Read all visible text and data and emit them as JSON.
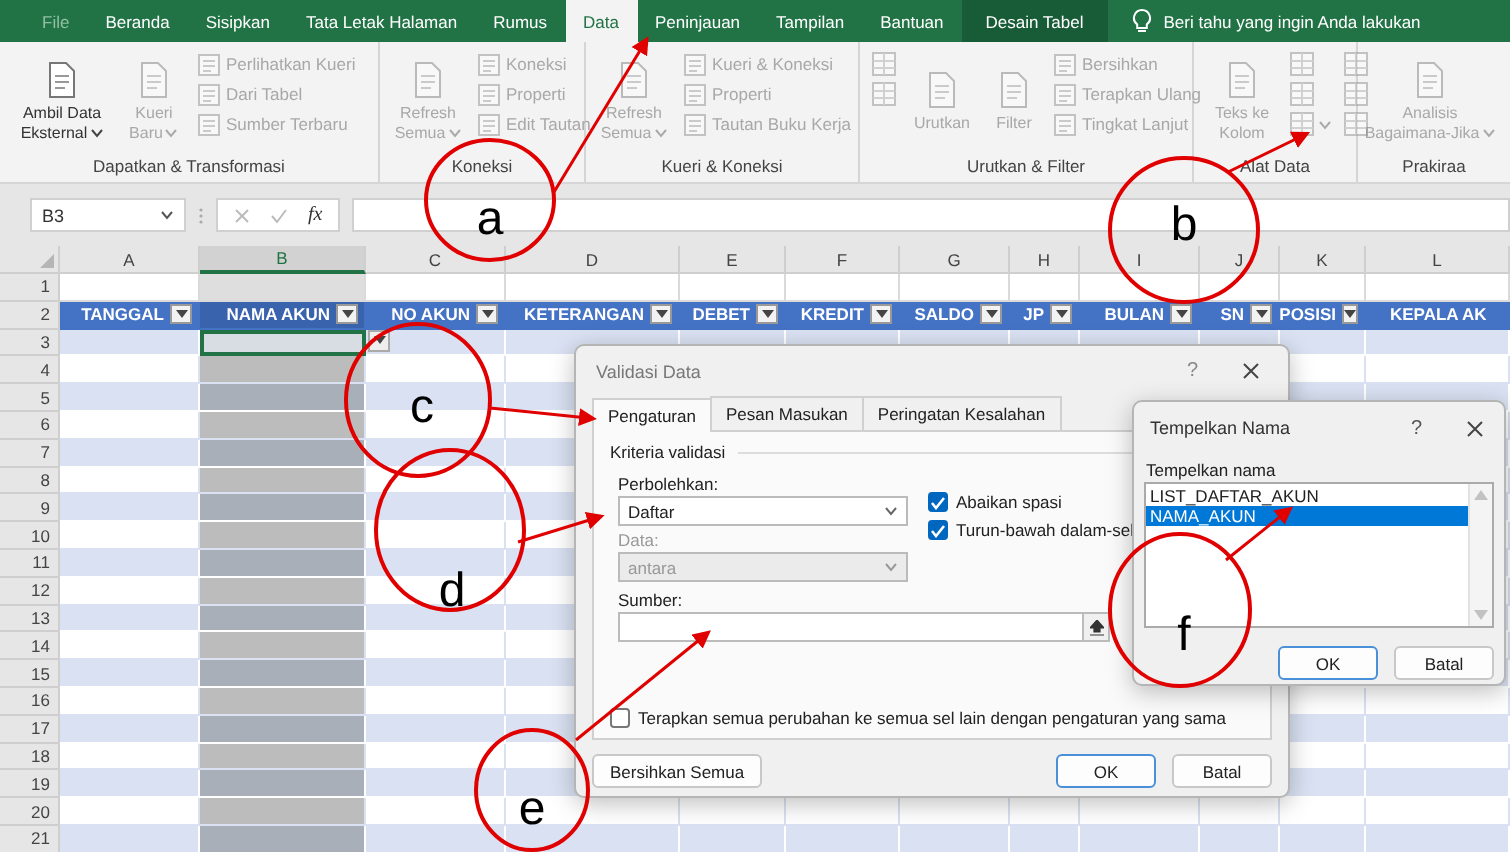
{
  "ribbon_tabs": [
    {
      "label": "File",
      "kind": "backstage",
      "selected": false
    },
    {
      "label": "Beranda",
      "kind": "standard",
      "selected": false
    },
    {
      "label": "Sisipkan",
      "kind": "standard",
      "selected": false
    },
    {
      "label": "Tata Letak Halaman",
      "kind": "standard",
      "selected": false
    },
    {
      "label": "Rumus",
      "kind": "standard",
      "selected": false
    },
    {
      "label": "Data",
      "kind": "standard",
      "selected": true
    },
    {
      "label": "Peninjauan",
      "kind": "standard",
      "selected": false
    },
    {
      "label": "Tampilan",
      "kind": "standard",
      "selected": false
    },
    {
      "label": "Bantuan",
      "kind": "standard",
      "selected": false
    },
    {
      "label": "Desain Tabel",
      "kind": "contextual",
      "selected": false
    }
  ],
  "tell_me": {
    "text": "Beri tahu yang ingin Anda lakukan"
  },
  "ribbon_groups": [
    {
      "title": "Dapatkan & Transformasi",
      "items": [
        {
          "kind": "large",
          "label": "Ambil Data Eksternal",
          "dropdown": true,
          "disabled": false
        },
        {
          "kind": "large",
          "label": "Kueri Baru",
          "dropdown": true,
          "disabled": true
        },
        {
          "kind": "stack",
          "items": [
            {
              "label": "Perlihatkan Kueri",
              "disabled": true
            },
            {
              "label": "Dari Tabel",
              "disabled": true
            },
            {
              "label": "Sumber Terbaru",
              "disabled": true
            }
          ]
        }
      ]
    },
    {
      "title": "Koneksi",
      "items": [
        {
          "kind": "large",
          "label": "Refresh Semua",
          "dropdown": true,
          "disabled": true
        },
        {
          "kind": "stack",
          "items": [
            {
              "label": "Koneksi",
              "disabled": true
            },
            {
              "label": "Properti",
              "disabled": true
            },
            {
              "label": "Edit Tautan",
              "disabled": true
            }
          ]
        }
      ]
    },
    {
      "title": "Kueri & Koneksi",
      "items": [
        {
          "kind": "large",
          "label": "Refresh Semua",
          "dropdown": true,
          "disabled": true
        },
        {
          "kind": "stack",
          "items": [
            {
              "label": "Kueri & Koneksi",
              "disabled": true
            },
            {
              "label": "Properti",
              "disabled": true
            },
            {
              "label": "Tautan Buku Kerja",
              "disabled": true
            }
          ]
        }
      ]
    },
    {
      "title": "Urutkan & Filter",
      "items": [
        {
          "kind": "icons",
          "items": [
            {
              "disabled": true,
              "dropdown": false
            },
            {
              "disabled": true,
              "dropdown": false
            }
          ]
        },
        {
          "kind": "large",
          "label": "Urutkan",
          "dropdown": false,
          "disabled": true
        },
        {
          "kind": "large",
          "label": "Filter",
          "dropdown": false,
          "disabled": true
        },
        {
          "kind": "stack",
          "items": [
            {
              "label": "Bersihkan",
              "disabled": true
            },
            {
              "label": "Terapkan Ulang",
              "disabled": true
            },
            {
              "label": "Tingkat Lanjut",
              "disabled": true
            }
          ]
        }
      ]
    },
    {
      "title": "Alat Data",
      "items": [
        {
          "kind": "large",
          "label": "Teks ke Kolom",
          "dropdown": false,
          "disabled": true
        },
        {
          "kind": "icons",
          "items": [
            {
              "disabled": true,
              "dropdown": false
            },
            {
              "disabled": true,
              "dropdown": false
            },
            {
              "disabled": true,
              "dropdown": true
            }
          ]
        },
        {
          "kind": "icons",
          "items": [
            {
              "disabled": true,
              "dropdown": false
            },
            {
              "disabled": true,
              "dropdown": false
            },
            {
              "disabled": true,
              "dropdown": false
            }
          ]
        }
      ]
    },
    {
      "title": "Prakiraa",
      "items": [
        {
          "kind": "large",
          "label": "Analisis Bagaimana-Jika",
          "dropdown": true,
          "disabled": true
        }
      ]
    }
  ],
  "formula_bar": {
    "name_box": "B3",
    "function_label": "fx"
  },
  "sheet": {
    "columns": [
      {
        "label": "A",
        "selected": false
      },
      {
        "label": "B",
        "selected": true
      },
      {
        "label": "C",
        "selected": false
      },
      {
        "label": "D",
        "selected": false
      },
      {
        "label": "E",
        "selected": false
      },
      {
        "label": "F",
        "selected": false
      },
      {
        "label": "G",
        "selected": false
      },
      {
        "label": "H",
        "selected": false
      },
      {
        "label": "I",
        "selected": false
      },
      {
        "label": "J",
        "selected": false
      },
      {
        "label": "K",
        "selected": false
      },
      {
        "label": "L",
        "selected": false
      }
    ],
    "table_headers": [
      {
        "label": "TANGGAL",
        "filter": true
      },
      {
        "label": "NAMA AKUN",
        "filter": true
      },
      {
        "label": "NO AKUN",
        "filter": true
      },
      {
        "label": "KETERANGAN",
        "filter": true
      },
      {
        "label": "DEBET",
        "filter": true
      },
      {
        "label": "KREDIT",
        "filter": true
      },
      {
        "label": "SALDO",
        "filter": true
      },
      {
        "label": "JP",
        "filter": true
      },
      {
        "label": "BULAN",
        "filter": true
      },
      {
        "label": "SN",
        "filter": true
      },
      {
        "label": "POSISI",
        "filter": true
      },
      {
        "label": "KEPALA AK",
        "filter": false
      }
    ],
    "rows": [
      {
        "number": "1",
        "kind": "blank",
        "active": false
      },
      {
        "number": "2",
        "kind": "header",
        "active": false
      },
      {
        "number": "3",
        "kind": "body",
        "active": true
      },
      {
        "number": "4",
        "kind": "body",
        "active": false
      },
      {
        "number": "5",
        "kind": "body",
        "active": false
      },
      {
        "number": "6",
        "kind": "body",
        "active": false
      },
      {
        "number": "7",
        "kind": "body",
        "active": false
      },
      {
        "number": "8",
        "kind": "body",
        "active": false
      },
      {
        "number": "9",
        "kind": "body",
        "active": false
      },
      {
        "number": "10",
        "kind": "body",
        "active": false
      },
      {
        "number": "11",
        "kind": "body",
        "active": false
      },
      {
        "number": "12",
        "kind": "body",
        "active": false
      },
      {
        "number": "13",
        "kind": "body",
        "active": false
      },
      {
        "number": "14",
        "kind": "body",
        "active": false
      },
      {
        "number": "15",
        "kind": "body",
        "active": false
      },
      {
        "number": "16",
        "kind": "body",
        "active": false
      },
      {
        "number": "17",
        "kind": "body",
        "active": false
      },
      {
        "number": "18",
        "kind": "body",
        "active": false
      },
      {
        "number": "19",
        "kind": "body",
        "active": false
      },
      {
        "number": "20",
        "kind": "body",
        "active": false
      },
      {
        "number": "21",
        "kind": "body",
        "active": false
      }
    ]
  },
  "validation_dialog": {
    "title": "Validasi Data",
    "help": "?",
    "tabs": [
      {
        "label": "Pengaturan",
        "selected": true
      },
      {
        "label": "Pesan Masukan",
        "selected": false
      },
      {
        "label": "Peringatan Kesalahan",
        "selected": false
      }
    ],
    "section": "Kriteria validasi",
    "allow_label": "Perbolehkan:",
    "allow_value": "Daftar",
    "checkboxes": [
      {
        "label": "Abaikan spasi",
        "checked": true
      },
      {
        "label": "Turun-bawah dalam-sel",
        "checked": true
      }
    ],
    "data_label": "Data:",
    "data_value": "antara",
    "data_disabled": true,
    "source_label": "Sumber:",
    "apply_all": {
      "label": "Terapkan semua perubahan ke semua sel lain dengan pengaturan yang sama",
      "checked": false
    },
    "buttons": [
      {
        "label": "Bersihkan Semua",
        "kind": "secondary"
      },
      {
        "label": "OK",
        "kind": "default"
      },
      {
        "label": "Batal",
        "kind": "secondary"
      }
    ]
  },
  "name_dialog": {
    "title": "Tempelkan Nama",
    "help": "?",
    "list_label": "Tempelkan nama",
    "names": [
      {
        "label": "LIST_DAFTAR_AKUN",
        "selected": false
      },
      {
        "label": "NAMA_AKUN",
        "selected": true
      }
    ],
    "buttons": [
      {
        "label": "OK",
        "kind": "default"
      },
      {
        "label": "Batal",
        "kind": "secondary"
      }
    ]
  },
  "annotations": [
    {
      "label": "a"
    },
    {
      "label": "b"
    },
    {
      "label": "c"
    },
    {
      "label": "d"
    },
    {
      "label": "e"
    },
    {
      "label": "f"
    }
  ]
}
